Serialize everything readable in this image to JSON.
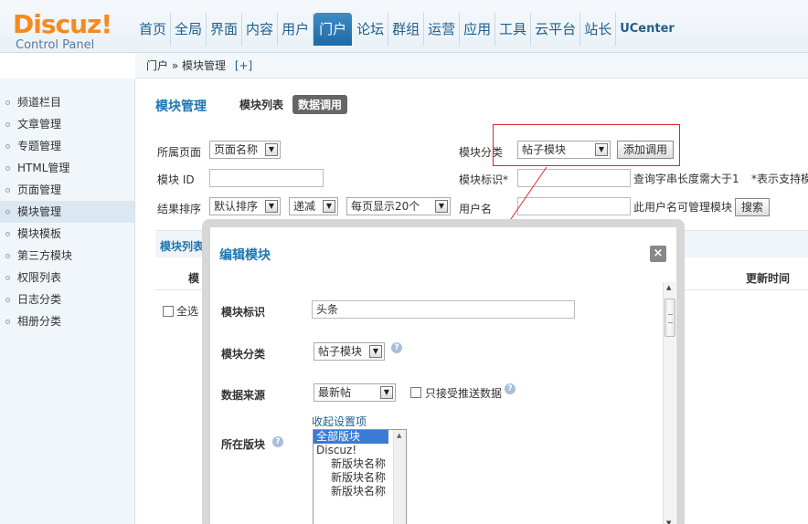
{
  "logo": {
    "brand": "Discuz!",
    "subtitle": "Control Panel"
  },
  "topnav": [
    "首页",
    "全局",
    "界面",
    "内容",
    "用户",
    "门户",
    "论坛",
    "群组",
    "运营",
    "应用",
    "工具",
    "云平台",
    "站长",
    "UCenter"
  ],
  "topnav_active": "门户",
  "breadcrumb": {
    "path": "门户 » 模块管理",
    "add": "[+]"
  },
  "sidebar": [
    "频道栏目",
    "文章管理",
    "专题管理",
    "HTML管理",
    "页面管理",
    "模块管理",
    "模块模板",
    "第三方模块",
    "权限列表",
    "日志分类",
    "相册分类"
  ],
  "sidebar_active": "模块管理",
  "main": {
    "title": "模块管理",
    "tabs": [
      "模块列表",
      "数据调用"
    ],
    "tab_active": "数据调用",
    "filters": {
      "page_label": "所属页面",
      "page_value": "页面名称",
      "id_label": "模块 ID",
      "sort_label": "结果排序",
      "sort_value": "默认排序",
      "order_value": "递减",
      "perpage_value": "每页显示20个",
      "category_label": "模块分类",
      "category_value": "帖子模块",
      "add_button": "添加调用",
      "mark_label": "模块标识*",
      "mark_hint": "查询字串长度需大于1",
      "mark_hint2": "*表示支持模",
      "user_label": "用户名",
      "user_hint": "此用户名可管理模块",
      "search_button": "搜索"
    },
    "list_title": "模块列表",
    "col_module": "模",
    "col_update": "更新时间",
    "select_all": "全选"
  },
  "dialog": {
    "title": "编辑模块",
    "close": "×",
    "mark_label": "模块标识",
    "mark_value": "头条",
    "category_label": "模块分类",
    "category_value": "帖子模块",
    "source_label": "数据来源",
    "source_value": "最新帖",
    "push_only": "只接受推送数据",
    "collapse_link": "收起设置项",
    "forum_label": "所在版块",
    "forum_options": [
      "全部版块",
      "Discuz!",
      "新版块名称",
      "新版块名称",
      "新版块名称"
    ]
  }
}
